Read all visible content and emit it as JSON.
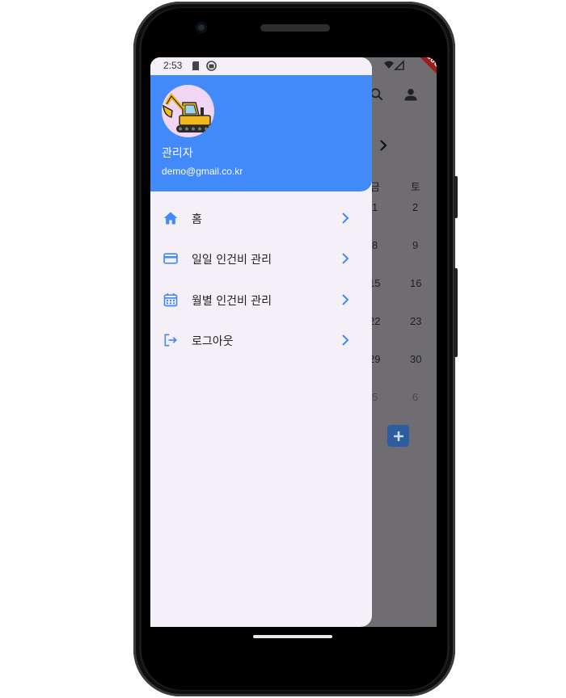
{
  "status_bar": {
    "time": "2:53"
  },
  "debug_banner": "DEBUG",
  "drawer": {
    "header": {
      "user_name": "관리자",
      "user_email": "demo@gmail.co.kr"
    },
    "menu": [
      {
        "label": "홈",
        "icon": "home-icon"
      },
      {
        "label": "일일 인건비 관리",
        "icon": "credit-card-icon"
      },
      {
        "label": "월별 인건비 관리",
        "icon": "calendar-icon"
      },
      {
        "label": "로그아웃",
        "icon": "logout-icon"
      }
    ]
  },
  "background_calendar": {
    "weekday_fri": "금",
    "weekday_sat": "토",
    "fri_days": [
      "1",
      "8",
      "15",
      "22",
      "29",
      "5"
    ],
    "sat_days": [
      "2",
      "9",
      "16",
      "23",
      "30",
      "6"
    ]
  },
  "colors": {
    "accent": "#4289f9",
    "drawer_bg": "#f5eff7",
    "scrim": "#6f6d72"
  }
}
